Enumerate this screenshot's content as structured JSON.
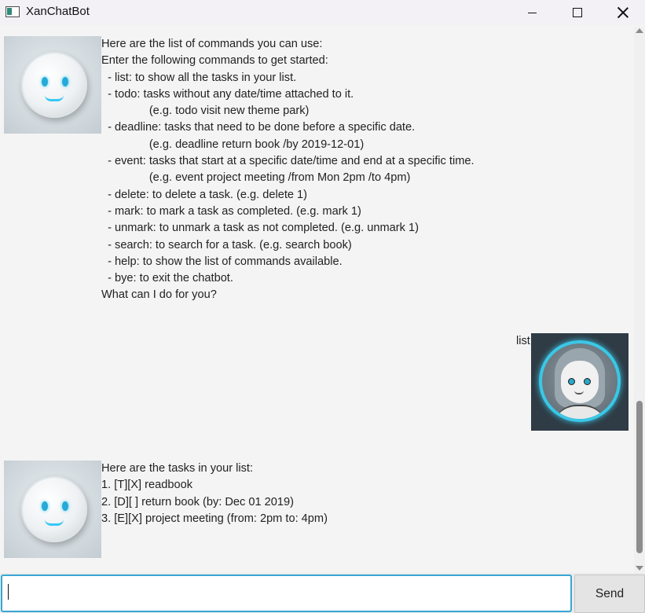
{
  "window": {
    "title": "XanChatBot",
    "controls": {
      "minimize": "minimize-icon",
      "maximize": "maximize-icon",
      "close": "close-icon"
    }
  },
  "conversation": {
    "bot_message_1": {
      "lines": [
        "Here are the list of commands you can use:",
        "Enter the following commands to get started:",
        "  - list: to show all the tasks in your list.",
        "  - todo: tasks without any date/time attached to it.",
        "               (e.g. todo visit new theme park)",
        "  - deadline: tasks that need to be done before a specific date.",
        "               (e.g. deadline return book /by 2019-12-01)",
        "  - event: tasks that start at a specific date/time and end at a specific time.",
        "               (e.g. event project meeting /from Mon 2pm /to 4pm)",
        "  - delete: to delete a task. (e.g. delete 1)",
        "  - mark: to mark a task as completed. (e.g. mark 1)",
        "  - unmark: to unmark a task as not completed. (e.g. unmark 1)",
        "  - search: to search for a task. (e.g. search book)",
        "  - help: to show the list of commands available.",
        "  - bye: to exit the chatbot.",
        "What can I do for you?"
      ]
    },
    "user_message_1": {
      "text": "list"
    },
    "bot_message_2": {
      "lines": [
        "Here are the tasks in your list:",
        "1. [T][X] readbook",
        "2. [D][ ] return book (by: Dec 01 2019)",
        "3. [E][X] project meeting (from: 2pm to: 4pm)"
      ]
    }
  },
  "input": {
    "value": "",
    "placeholder": ""
  },
  "send_button": {
    "label": "Send"
  },
  "colors": {
    "accent": "#38a6d4",
    "glow": "#3bc7e6",
    "background": "#f4f4f4"
  }
}
